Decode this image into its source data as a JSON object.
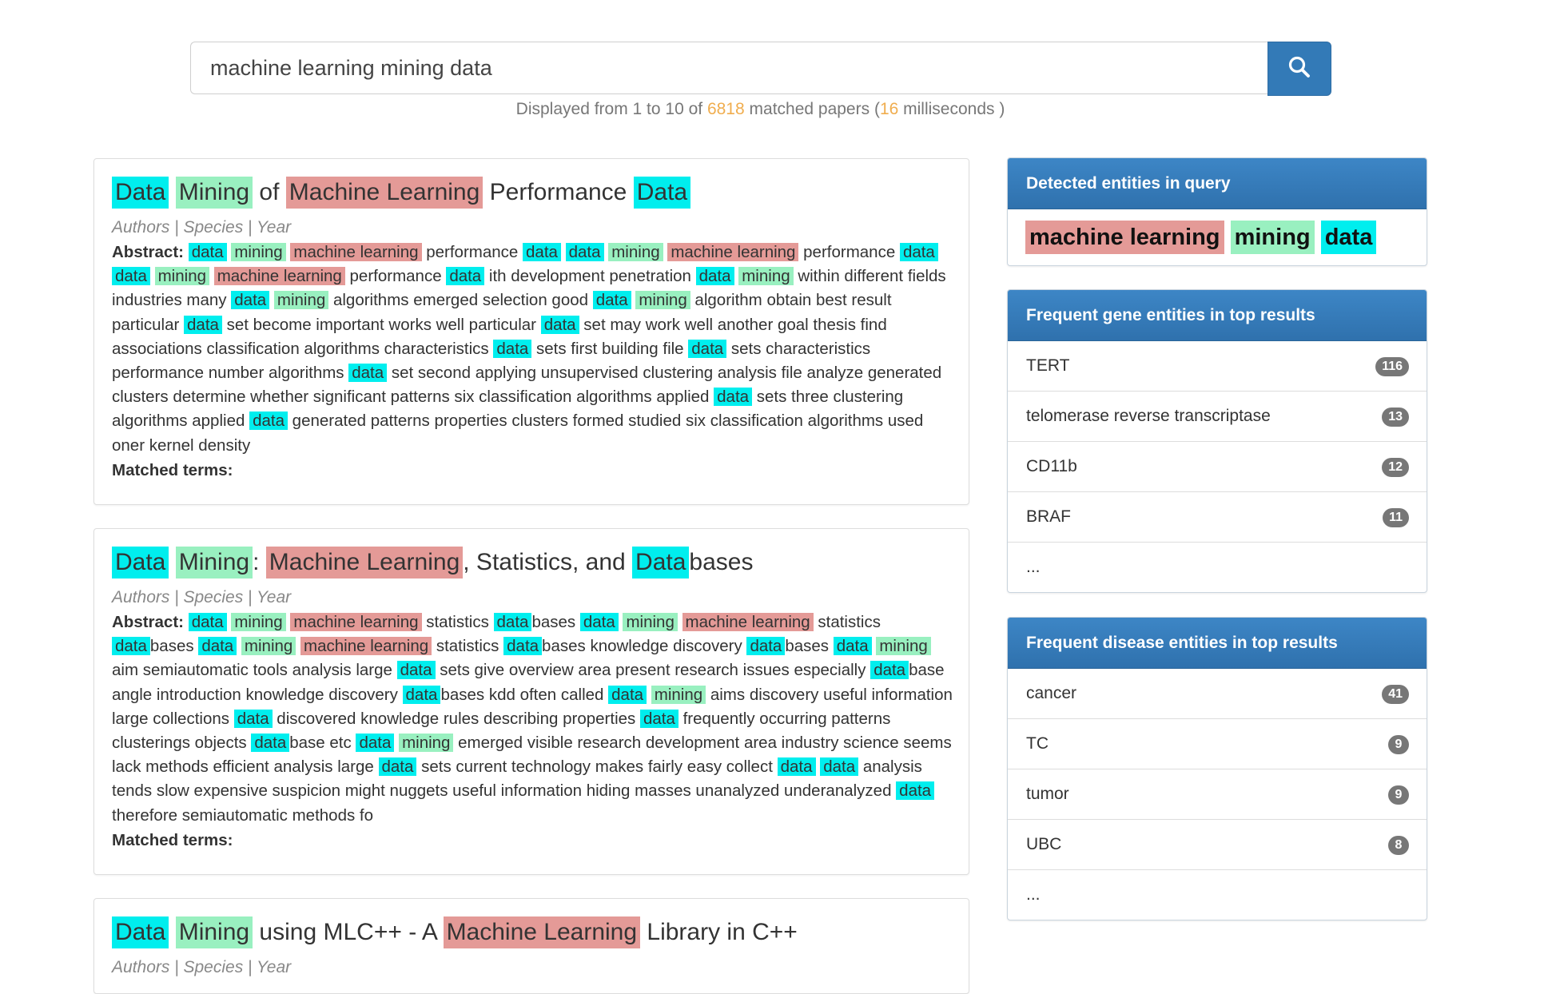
{
  "search": {
    "value": "machine learning mining data",
    "button_icon": "search-icon"
  },
  "summary": {
    "prefix": "Displayed from 1 to 10 of",
    "count": "6818",
    "middle": "matched papers (",
    "ms": "16",
    "suffix": "milliseconds )"
  },
  "colors": {
    "data_highlight": "#00eeee",
    "mining_highlight": "#99f0c0",
    "ml_highlight": "#e49a97",
    "panel_header": "#337ab7",
    "count_orange": "#f0ad4e"
  },
  "results": [
    {
      "title": [
        {
          "t": "Data",
          "c": "data"
        },
        {
          "t": " ",
          "c": ""
        },
        {
          "t": "Mining",
          "c": "mining"
        },
        {
          "t": " of ",
          "c": ""
        },
        {
          "t": "Machine Learning",
          "c": "ml"
        },
        {
          "t": " Performance ",
          "c": ""
        },
        {
          "t": "Data",
          "c": "data"
        }
      ],
      "meta": "Authors | Species | Year",
      "abstract_label": "Abstract:",
      "abstract": [
        {
          "t": "data",
          "c": "data"
        },
        {
          "t": " ",
          "c": ""
        },
        {
          "t": "mining",
          "c": "mining"
        },
        {
          "t": " ",
          "c": ""
        },
        {
          "t": "machine learning",
          "c": "ml"
        },
        {
          "t": " performance ",
          "c": ""
        },
        {
          "t": "data",
          "c": "data"
        },
        {
          "t": " ",
          "c": ""
        },
        {
          "t": "data",
          "c": "data"
        },
        {
          "t": " ",
          "c": ""
        },
        {
          "t": "mining",
          "c": "mining"
        },
        {
          "t": " ",
          "c": ""
        },
        {
          "t": "machine learning",
          "c": "ml"
        },
        {
          "t": " performance ",
          "c": ""
        },
        {
          "t": "data",
          "c": "data"
        },
        {
          "t": " ",
          "c": ""
        },
        {
          "t": "data",
          "c": "data"
        },
        {
          "t": " ",
          "c": ""
        },
        {
          "t": "mining",
          "c": "mining"
        },
        {
          "t": " ",
          "c": ""
        },
        {
          "t": "machine learning",
          "c": "ml"
        },
        {
          "t": " performance ",
          "c": ""
        },
        {
          "t": "data",
          "c": "data"
        },
        {
          "t": " ith development penetration ",
          "c": ""
        },
        {
          "t": "data",
          "c": "data"
        },
        {
          "t": " ",
          "c": ""
        },
        {
          "t": "mining",
          "c": "mining"
        },
        {
          "t": " within different fields industries many ",
          "c": ""
        },
        {
          "t": "data",
          "c": "data"
        },
        {
          "t": " ",
          "c": ""
        },
        {
          "t": "mining",
          "c": "mining"
        },
        {
          "t": " algorithms emerged selection good ",
          "c": ""
        },
        {
          "t": "data",
          "c": "data"
        },
        {
          "t": " ",
          "c": ""
        },
        {
          "t": "mining",
          "c": "mining"
        },
        {
          "t": " algorithm obtain best result particular ",
          "c": ""
        },
        {
          "t": "data",
          "c": "data"
        },
        {
          "t": " set become important works well particular ",
          "c": ""
        },
        {
          "t": "data",
          "c": "data"
        },
        {
          "t": " set may work well another goal thesis find associations classification algorithms characteristics ",
          "c": ""
        },
        {
          "t": "data",
          "c": "data"
        },
        {
          "t": " sets first building file ",
          "c": ""
        },
        {
          "t": "data",
          "c": "data"
        },
        {
          "t": " sets characteristics performance number algorithms ",
          "c": ""
        },
        {
          "t": "data",
          "c": "data"
        },
        {
          "t": " set second applying unsupervised clustering analysis file analyze generated clusters determine whether significant patterns six classification algorithms applied ",
          "c": ""
        },
        {
          "t": "data",
          "c": "data"
        },
        {
          "t": " sets three clustering algorithms applied ",
          "c": ""
        },
        {
          "t": "data",
          "c": "data"
        },
        {
          "t": " generated patterns properties clusters formed studied six classification algorithms used oner kernel density",
          "c": ""
        }
      ],
      "matched_label": "Matched terms:"
    },
    {
      "title": [
        {
          "t": "Data",
          "c": "data"
        },
        {
          "t": " ",
          "c": ""
        },
        {
          "t": "Mining",
          "c": "mining"
        },
        {
          "t": ": ",
          "c": ""
        },
        {
          "t": "Machine Learning",
          "c": "ml"
        },
        {
          "t": ", Statistics, and ",
          "c": ""
        },
        {
          "t": "Data",
          "c": "data"
        },
        {
          "t": "bases",
          "c": ""
        }
      ],
      "meta": "Authors | Species | Year",
      "abstract_label": "Abstract:",
      "abstract": [
        {
          "t": "data",
          "c": "data"
        },
        {
          "t": " ",
          "c": ""
        },
        {
          "t": "mining",
          "c": "mining"
        },
        {
          "t": " ",
          "c": ""
        },
        {
          "t": "machine learning",
          "c": "ml"
        },
        {
          "t": " statistics ",
          "c": ""
        },
        {
          "t": "data",
          "c": "data"
        },
        {
          "t": "bases ",
          "c": ""
        },
        {
          "t": "data",
          "c": "data"
        },
        {
          "t": " ",
          "c": ""
        },
        {
          "t": "mining",
          "c": "mining"
        },
        {
          "t": " ",
          "c": ""
        },
        {
          "t": "machine learning",
          "c": "ml"
        },
        {
          "t": " statistics ",
          "c": ""
        },
        {
          "t": "data",
          "c": "data"
        },
        {
          "t": "bases ",
          "c": ""
        },
        {
          "t": "data",
          "c": "data"
        },
        {
          "t": " ",
          "c": ""
        },
        {
          "t": "mining",
          "c": "mining"
        },
        {
          "t": " ",
          "c": ""
        },
        {
          "t": "machine learning",
          "c": "ml"
        },
        {
          "t": " statistics ",
          "c": ""
        },
        {
          "t": "data",
          "c": "data"
        },
        {
          "t": "bases knowledge discovery ",
          "c": ""
        },
        {
          "t": "data",
          "c": "data"
        },
        {
          "t": "bases ",
          "c": ""
        },
        {
          "t": "data",
          "c": "data"
        },
        {
          "t": " ",
          "c": ""
        },
        {
          "t": "mining",
          "c": "mining"
        },
        {
          "t": " aim semiautomatic tools analysis large ",
          "c": ""
        },
        {
          "t": "data",
          "c": "data"
        },
        {
          "t": " sets give overview area present research issues especially ",
          "c": ""
        },
        {
          "t": "data",
          "c": "data"
        },
        {
          "t": "base angle introduction knowledge discovery ",
          "c": ""
        },
        {
          "t": "data",
          "c": "data"
        },
        {
          "t": "bases kdd often called ",
          "c": ""
        },
        {
          "t": "data",
          "c": "data"
        },
        {
          "t": " ",
          "c": ""
        },
        {
          "t": "mining",
          "c": "mining"
        },
        {
          "t": " aims discovery useful information large collections ",
          "c": ""
        },
        {
          "t": "data",
          "c": "data"
        },
        {
          "t": " discovered knowledge rules describing properties ",
          "c": ""
        },
        {
          "t": "data",
          "c": "data"
        },
        {
          "t": " frequently occurring patterns clusterings objects ",
          "c": ""
        },
        {
          "t": "data",
          "c": "data"
        },
        {
          "t": "base etc ",
          "c": ""
        },
        {
          "t": "data",
          "c": "data"
        },
        {
          "t": " ",
          "c": ""
        },
        {
          "t": "mining",
          "c": "mining"
        },
        {
          "t": " emerged visible research development area industry science seems lack methods efficient analysis large ",
          "c": ""
        },
        {
          "t": "data",
          "c": "data"
        },
        {
          "t": " sets current technology makes fairly easy collect ",
          "c": ""
        },
        {
          "t": "data",
          "c": "data"
        },
        {
          "t": " ",
          "c": ""
        },
        {
          "t": "data",
          "c": "data"
        },
        {
          "t": " analysis tends slow expensive suspicion might nuggets useful information hiding masses unanalyzed underanalyzed ",
          "c": ""
        },
        {
          "t": "data",
          "c": "data"
        },
        {
          "t": " therefore semiautomatic methods fo",
          "c": ""
        }
      ],
      "matched_label": "Matched terms:"
    },
    {
      "title": [
        {
          "t": "Data",
          "c": "data"
        },
        {
          "t": " ",
          "c": ""
        },
        {
          "t": "Mining",
          "c": "mining"
        },
        {
          "t": " using MLC++ - A ",
          "c": ""
        },
        {
          "t": "Machine Learning",
          "c": "ml"
        },
        {
          "t": " Library in C++",
          "c": ""
        }
      ],
      "meta": "Authors | Species | Year"
    }
  ],
  "panels": {
    "query_entities": {
      "title": "Detected entities in query",
      "entities": [
        {
          "t": "machine learning",
          "c": "ml"
        },
        {
          "t": "mining",
          "c": "mining"
        },
        {
          "t": "data",
          "c": "data"
        }
      ]
    },
    "gene": {
      "title": "Frequent gene entities in top results",
      "items": [
        {
          "label": "TERT",
          "count": "116"
        },
        {
          "label": "telomerase reverse transcriptase",
          "count": "13"
        },
        {
          "label": "CD11b",
          "count": "12"
        },
        {
          "label": "BRAF",
          "count": "11"
        },
        {
          "label": "...",
          "count": ""
        }
      ]
    },
    "disease": {
      "title": "Frequent disease entities in top results",
      "items": [
        {
          "label": "cancer",
          "count": "41"
        },
        {
          "label": "TC",
          "count": "9"
        },
        {
          "label": "tumor",
          "count": "9"
        },
        {
          "label": "UBC",
          "count": "8"
        },
        {
          "label": "...",
          "count": ""
        }
      ]
    }
  }
}
